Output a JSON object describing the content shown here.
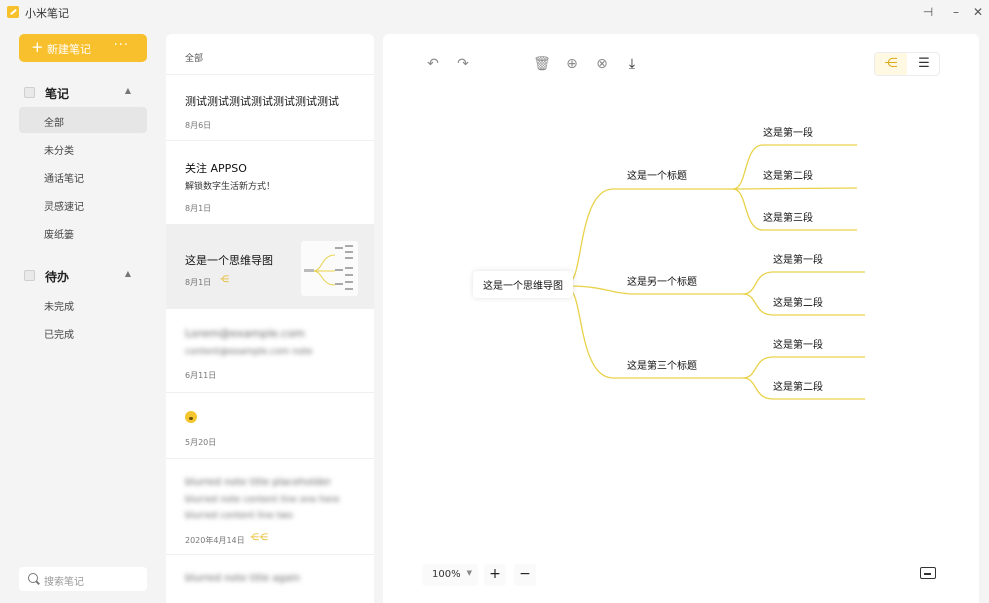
{
  "app": {
    "title": "小米笔记"
  },
  "sidebar": {
    "new_note": "新建笔记",
    "more": "···",
    "notes_section": "笔记",
    "notes_items": [
      "全部",
      "未分类",
      "通话笔记",
      "灵感速记",
      "废纸篓"
    ],
    "todo_section": "待办",
    "todo_items": [
      "未完成",
      "已完成"
    ],
    "search_placeholder": "搜索笔记"
  },
  "list": {
    "header": "全部",
    "notes": [
      {
        "title": "测试测试测试测试测试测试测试",
        "date": "8月6日"
      },
      {
        "title": "关注 APPSO",
        "subtitle": "解锁数字生活新方式！",
        "date": "8月1日"
      },
      {
        "title": "这是一个思维导图",
        "date": "8月1日"
      },
      {
        "title": "Lorem@example.com",
        "subtitle": "content@example.com note",
        "date": "6月11日"
      },
      {
        "date": "5月20日"
      },
      {
        "title": "blurred note title placeholder",
        "subtitle": "blurred note content line one here",
        "subtitle2": "blurred content line two",
        "date": "2020年4月14日"
      },
      {
        "title": "blurred note title again"
      }
    ]
  },
  "editor": {
    "zoom": "100%",
    "mindmap": {
      "root": "这是一个思维导图",
      "branches": [
        {
          "label": "这是一个标题",
          "children": [
            "这是第一段",
            "这是第二段",
            "这是第三段"
          ]
        },
        {
          "label": "这是另一个标题",
          "children": [
            "这是第一段",
            "这是第二段"
          ]
        },
        {
          "label": "这是第三个标题",
          "children": [
            "这是第一段",
            "这是第二段"
          ]
        }
      ]
    },
    "colors": {
      "accent": "#f8c02c",
      "line": "#e9d24a"
    }
  }
}
